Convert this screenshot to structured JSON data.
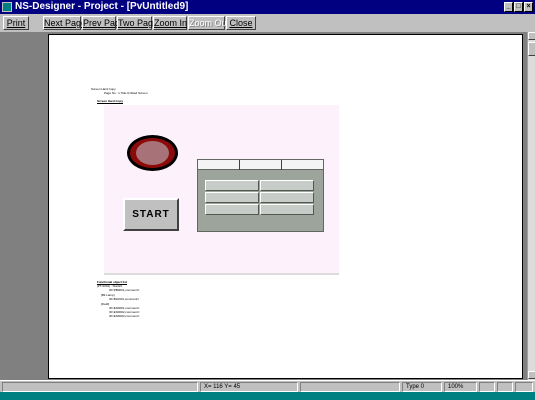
{
  "window": {
    "title": "NS-Designer - Project - [PvUntitled9]",
    "controls": {
      "minimize": "_",
      "restore": "□",
      "close": "×"
    }
  },
  "toolbar": {
    "print": "Print",
    "next_page": "Next Page",
    "prev_page": "Prev Page",
    "two_page": "Two Page",
    "zoom_in": "Zoom In",
    "zoom_out": "Zoom Out",
    "close": "Close"
  },
  "preview": {
    "header_line1": "Screen Hard Copy",
    "header_line2": "Page No : 1  Title:Untitled Screen",
    "section_title": "Screen Hard Copy",
    "start_button_label": "START",
    "table": {
      "columns": 3,
      "rows": 3
    },
    "functional": {
      "title": "Functional object list",
      "lines": [
        "[PT-0001] : Start#1",
        "ID=PB0001,comment=",
        "[Bit Lamp]",
        "ID=BL0001,comment=",
        "[Field]",
        "ID=EN0001,comment=",
        "ID=EN0002,comment=",
        "ID=EN0003,comment="
      ]
    }
  },
  "status": {
    "coords": "X= 116 Y= 45",
    "type": "Type 0",
    "zoom": "100%"
  },
  "colors": {
    "titlebar": "#000080",
    "face": "#c0c0c0",
    "workspace": "#808080",
    "canvas": "#fdf2fb",
    "lamp_ring": "#8b0a0a",
    "lamp_core": "#a87378",
    "table_bg": "#9ca49c"
  }
}
